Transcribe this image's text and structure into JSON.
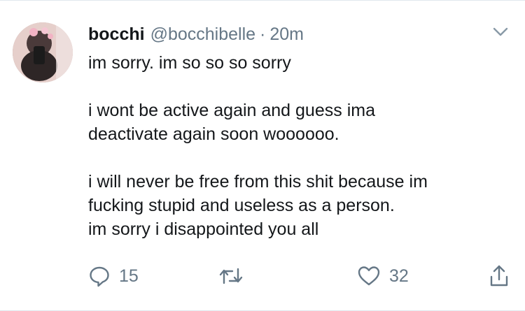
{
  "tweet": {
    "display_name": "bocchi",
    "handle": "@bocchibelle",
    "separator": "·",
    "timestamp": "20m",
    "lines": [
      "im sorry. im so so so sorry",
      "",
      "i wont be active again and guess ima",
      "deactivate again soon woooooo.",
      "",
      "i will never be free from this shit because im",
      "fucking stupid and useless as a person.",
      "im sorry i disappointed you all"
    ]
  },
  "actions": {
    "reply": {
      "icon": "reply-icon",
      "count": "15"
    },
    "retweet": {
      "icon": "retweet-icon",
      "count": ""
    },
    "like": {
      "icon": "heart-icon",
      "count": "32"
    },
    "share": {
      "icon": "share-icon"
    }
  },
  "colors": {
    "text": "#14171a",
    "secondary": "#657786",
    "border": "#e1e8ed"
  }
}
